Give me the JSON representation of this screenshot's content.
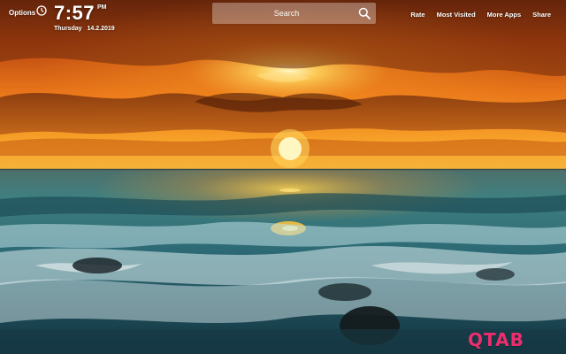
{
  "header": {
    "options_label": "Options",
    "time": "7:57",
    "ampm": "PM",
    "weekday": "Thursday",
    "date": "14.2.2019"
  },
  "search": {
    "placeholder": "Search",
    "icon": "search-icon"
  },
  "nav": {
    "rate": "Rate",
    "most_visited": "Most Visited",
    "more_apps": "More Apps",
    "share": "Share"
  },
  "brand": {
    "logo_text": "QTAB",
    "logo_color": "#ec2e6e"
  },
  "background": {
    "description_colors": {
      "sky_top": "#7a2e0c",
      "sky_glow": "#f08a1a",
      "sun": "#fff6b0",
      "sea": "#2a6f78",
      "foam": "#dfeff3"
    }
  }
}
